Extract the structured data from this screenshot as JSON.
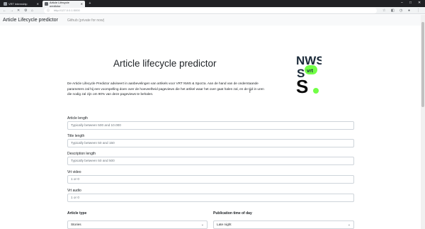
{
  "browser": {
    "tabs": [
      {
        "label": "VRT Internship"
      },
      {
        "label": "Article Lifecycle predictor"
      }
    ],
    "url": "http://127.0.0.1:5000"
  },
  "navbar": {
    "brand": "Article Lifecycle predictor",
    "link": "Github (private for now)"
  },
  "page": {
    "title": "Article lifecycle predictor",
    "intro": "De Article Lifecycle Predictor adviseert in aanbevelingen van artikels voor VRT NWS & Sporza. Aan de hand van de onderstaande parameters zal hij een voorspelling doen over de hoeveelheid pageviews die het artikel waar het over gaat halen zal, en de tijd in uren die nodig zal zijn om 90% van deze pageviews te behalen."
  },
  "logo": {
    "line1": "NWS",
    "badge": "vrt",
    "line3": "S",
    "accent": "#72ff47",
    "navy": "#1c2b3a"
  },
  "form": {
    "fields": [
      {
        "label": "Article length",
        "placeholder": "Typically between 500 and 10.000"
      },
      {
        "label": "Title length",
        "placeholder": "Typically between 50 and 150"
      },
      {
        "label": "Description length",
        "placeholder": "Typically between 50 and 500"
      },
      {
        "label": "Vrt video",
        "placeholder": "1 or 0"
      },
      {
        "label": "Vrt audio",
        "placeholder": "1 or 0"
      }
    ],
    "article_type": {
      "label": "Article type",
      "value": "Stories"
    },
    "publication_time": {
      "label": "Publication time of day",
      "value": "Late night"
    }
  }
}
